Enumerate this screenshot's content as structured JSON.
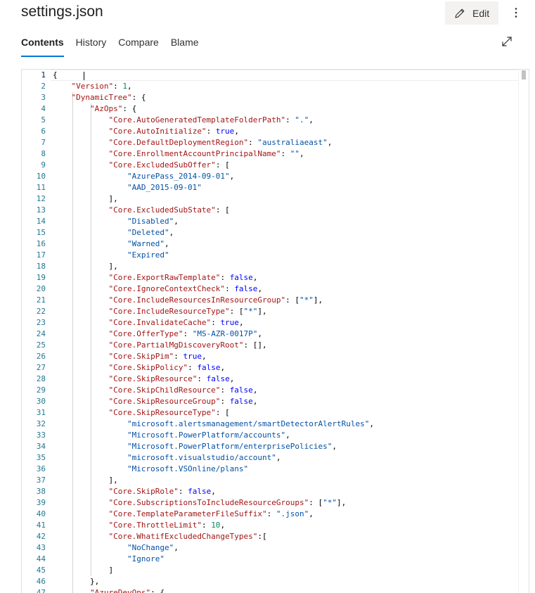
{
  "header": {
    "title": "settings.json",
    "edit_label": "Edit",
    "edit_icon": "pencil-icon",
    "more_icon": "more-vertical-icon"
  },
  "tabs": [
    {
      "label": "Contents",
      "active": true
    },
    {
      "label": "History",
      "active": false
    },
    {
      "label": "Compare",
      "active": false
    },
    {
      "label": "Blame",
      "active": false
    }
  ],
  "expand_icon": "expand-icon",
  "editor": {
    "current_line": 1,
    "lines": [
      [
        [
          "p",
          "{"
        ]
      ],
      [
        [
          "p",
          "    "
        ],
        [
          "k",
          "\"Version\""
        ],
        [
          "p",
          ": "
        ],
        [
          "n",
          "1"
        ],
        [
          "p",
          ","
        ]
      ],
      [
        [
          "p",
          "    "
        ],
        [
          "k",
          "\"DynamicTree\""
        ],
        [
          "p",
          ": {"
        ]
      ],
      [
        [
          "p",
          "        "
        ],
        [
          "k",
          "\"AzOps\""
        ],
        [
          "p",
          ": {"
        ]
      ],
      [
        [
          "p",
          "            "
        ],
        [
          "k",
          "\"Core.AutoGeneratedTemplateFolderPath\""
        ],
        [
          "p",
          ": "
        ],
        [
          "s",
          "\".\""
        ],
        [
          "p",
          ","
        ]
      ],
      [
        [
          "p",
          "            "
        ],
        [
          "k",
          "\"Core.AutoInitialize\""
        ],
        [
          "p",
          ": "
        ],
        [
          "b",
          "true"
        ],
        [
          "p",
          ","
        ]
      ],
      [
        [
          "p",
          "            "
        ],
        [
          "k",
          "\"Core.DefaultDeploymentRegion\""
        ],
        [
          "p",
          ": "
        ],
        [
          "s",
          "\"australiaeast\""
        ],
        [
          "p",
          ","
        ]
      ],
      [
        [
          "p",
          "            "
        ],
        [
          "k",
          "\"Core.EnrollmentAccountPrincipalName\""
        ],
        [
          "p",
          ": "
        ],
        [
          "s",
          "\"\""
        ],
        [
          "p",
          ","
        ]
      ],
      [
        [
          "p",
          "            "
        ],
        [
          "k",
          "\"Core.ExcludedSubOffer\""
        ],
        [
          "p",
          ": ["
        ]
      ],
      [
        [
          "p",
          "                "
        ],
        [
          "s",
          "\"AzurePass_2014-09-01\""
        ],
        [
          "p",
          ","
        ]
      ],
      [
        [
          "p",
          "                "
        ],
        [
          "s",
          "\"AAD_2015-09-01\""
        ]
      ],
      [
        [
          "p",
          "            ],"
        ]
      ],
      [
        [
          "p",
          "            "
        ],
        [
          "k",
          "\"Core.ExcludedSubState\""
        ],
        [
          "p",
          ": ["
        ]
      ],
      [
        [
          "p",
          "                "
        ],
        [
          "s",
          "\"Disabled\""
        ],
        [
          "p",
          ","
        ]
      ],
      [
        [
          "p",
          "                "
        ],
        [
          "s",
          "\"Deleted\""
        ],
        [
          "p",
          ","
        ]
      ],
      [
        [
          "p",
          "                "
        ],
        [
          "s",
          "\"Warned\""
        ],
        [
          "p",
          ","
        ]
      ],
      [
        [
          "p",
          "                "
        ],
        [
          "s",
          "\"Expired\""
        ]
      ],
      [
        [
          "p",
          "            ],"
        ]
      ],
      [
        [
          "p",
          "            "
        ],
        [
          "k",
          "\"Core.ExportRawTemplate\""
        ],
        [
          "p",
          ": "
        ],
        [
          "b",
          "false"
        ],
        [
          "p",
          ","
        ]
      ],
      [
        [
          "p",
          "            "
        ],
        [
          "k",
          "\"Core.IgnoreContextCheck\""
        ],
        [
          "p",
          ": "
        ],
        [
          "b",
          "false"
        ],
        [
          "p",
          ","
        ]
      ],
      [
        [
          "p",
          "            "
        ],
        [
          "k",
          "\"Core.IncludeResourcesInResourceGroup\""
        ],
        [
          "p",
          ": ["
        ],
        [
          "s",
          "\"*\""
        ],
        [
          "p",
          "],"
        ]
      ],
      [
        [
          "p",
          "            "
        ],
        [
          "k",
          "\"Core.IncludeResourceType\""
        ],
        [
          "p",
          ": ["
        ],
        [
          "s",
          "\"*\""
        ],
        [
          "p",
          "],"
        ]
      ],
      [
        [
          "p",
          "            "
        ],
        [
          "k",
          "\"Core.InvalidateCache\""
        ],
        [
          "p",
          ": "
        ],
        [
          "b",
          "true"
        ],
        [
          "p",
          ","
        ]
      ],
      [
        [
          "p",
          "            "
        ],
        [
          "k",
          "\"Core.OfferType\""
        ],
        [
          "p",
          ": "
        ],
        [
          "s",
          "\"MS-AZR-0017P\""
        ],
        [
          "p",
          ","
        ]
      ],
      [
        [
          "p",
          "            "
        ],
        [
          "k",
          "\"Core.PartialMgDiscoveryRoot\""
        ],
        [
          "p",
          ": [],"
        ]
      ],
      [
        [
          "p",
          "            "
        ],
        [
          "k",
          "\"Core.SkipPim\""
        ],
        [
          "p",
          ": "
        ],
        [
          "b",
          "true"
        ],
        [
          "p",
          ","
        ]
      ],
      [
        [
          "p",
          "            "
        ],
        [
          "k",
          "\"Core.SkipPolicy\""
        ],
        [
          "p",
          ": "
        ],
        [
          "b",
          "false"
        ],
        [
          "p",
          ","
        ]
      ],
      [
        [
          "p",
          "            "
        ],
        [
          "k",
          "\"Core.SkipResource\""
        ],
        [
          "p",
          ": "
        ],
        [
          "b",
          "false"
        ],
        [
          "p",
          ","
        ]
      ],
      [
        [
          "p",
          "            "
        ],
        [
          "k",
          "\"Core.SkipChildResource\""
        ],
        [
          "p",
          ": "
        ],
        [
          "b",
          "false"
        ],
        [
          "p",
          ","
        ]
      ],
      [
        [
          "p",
          "            "
        ],
        [
          "k",
          "\"Core.SkipResourceGroup\""
        ],
        [
          "p",
          ": "
        ],
        [
          "b",
          "false"
        ],
        [
          "p",
          ","
        ]
      ],
      [
        [
          "p",
          "            "
        ],
        [
          "k",
          "\"Core.SkipResourceType\""
        ],
        [
          "p",
          ": ["
        ]
      ],
      [
        [
          "p",
          "                "
        ],
        [
          "s",
          "\"microsoft.alertsmanagement/smartDetectorAlertRules\""
        ],
        [
          "p",
          ","
        ]
      ],
      [
        [
          "p",
          "                "
        ],
        [
          "s",
          "\"Microsoft.PowerPlatform/accounts\""
        ],
        [
          "p",
          ","
        ]
      ],
      [
        [
          "p",
          "                "
        ],
        [
          "s",
          "\"Microsoft.PowerPlatform/enterprisePolicies\""
        ],
        [
          "p",
          ","
        ]
      ],
      [
        [
          "p",
          "                "
        ],
        [
          "s",
          "\"microsoft.visualstudio/account\""
        ],
        [
          "p",
          ","
        ]
      ],
      [
        [
          "p",
          "                "
        ],
        [
          "s",
          "\"Microsoft.VSOnline/plans\""
        ]
      ],
      [
        [
          "p",
          "            ],"
        ]
      ],
      [
        [
          "p",
          "            "
        ],
        [
          "k",
          "\"Core.SkipRole\""
        ],
        [
          "p",
          ": "
        ],
        [
          "b",
          "false"
        ],
        [
          "p",
          ","
        ]
      ],
      [
        [
          "p",
          "            "
        ],
        [
          "k",
          "\"Core.SubscriptionsToIncludeResourceGroups\""
        ],
        [
          "p",
          ": ["
        ],
        [
          "s",
          "\"*\""
        ],
        [
          "p",
          "],"
        ]
      ],
      [
        [
          "p",
          "            "
        ],
        [
          "k",
          "\"Core.TemplateParameterFileSuffix\""
        ],
        [
          "p",
          ": "
        ],
        [
          "s",
          "\".json\""
        ],
        [
          "p",
          ","
        ]
      ],
      [
        [
          "p",
          "            "
        ],
        [
          "k",
          "\"Core.ThrottleLimit\""
        ],
        [
          "p",
          ": "
        ],
        [
          "n",
          "10"
        ],
        [
          "p",
          ","
        ]
      ],
      [
        [
          "p",
          "            "
        ],
        [
          "k",
          "\"Core.WhatifExcludedChangeTypes\""
        ],
        [
          "p",
          ":["
        ]
      ],
      [
        [
          "p",
          "                "
        ],
        [
          "s",
          "\"NoChange\""
        ],
        [
          "p",
          ","
        ]
      ],
      [
        [
          "p",
          "                "
        ],
        [
          "s",
          "\"Ignore\""
        ]
      ],
      [
        [
          "p",
          "            ]"
        ]
      ],
      [
        [
          "p",
          "        },"
        ]
      ],
      [
        [
          "p",
          "        "
        ],
        [
          "k",
          "\"AzureDevOps\""
        ],
        [
          "p",
          ": {"
        ]
      ]
    ]
  }
}
